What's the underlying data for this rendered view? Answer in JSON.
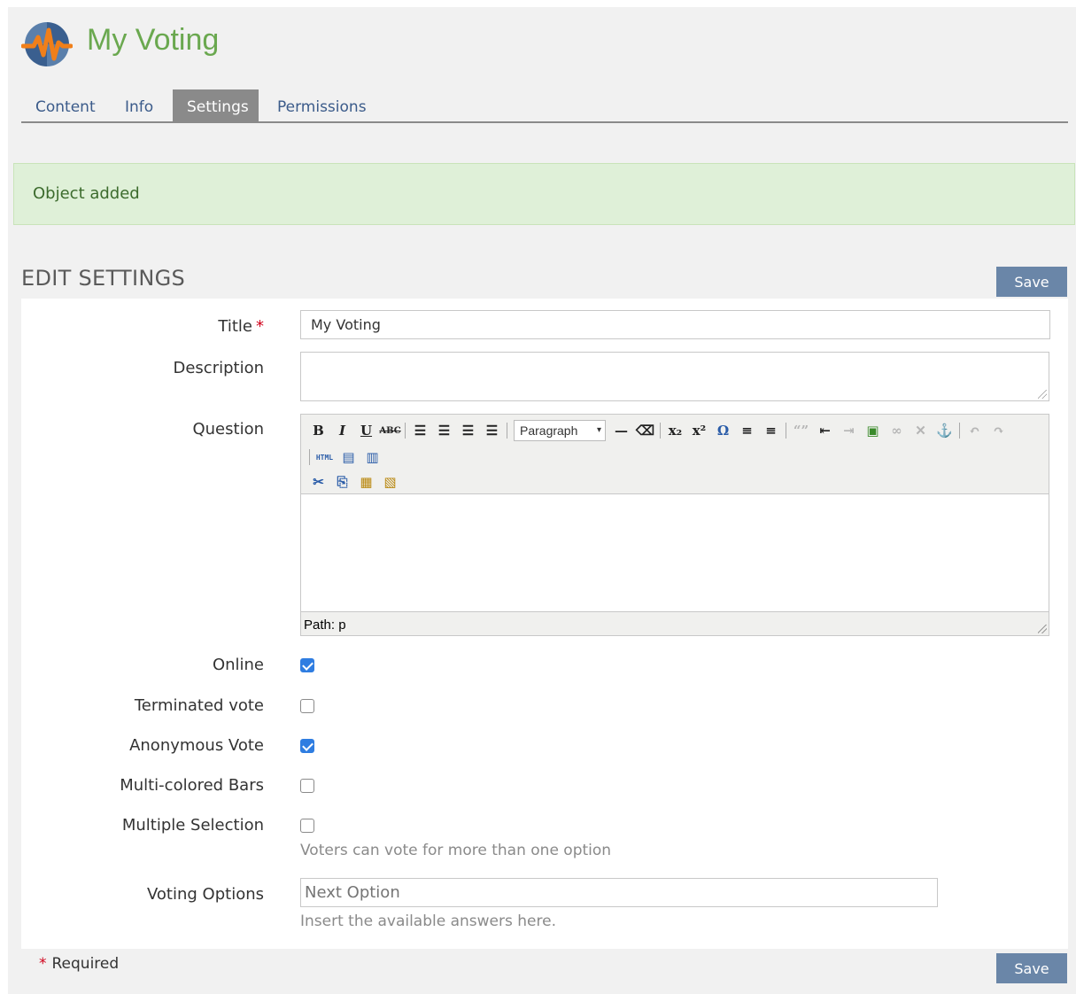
{
  "header": {
    "title": "My Voting"
  },
  "tabs": [
    {
      "label": "Content"
    },
    {
      "label": "Info"
    },
    {
      "label": "Settings",
      "active": true
    },
    {
      "label": "Permissions"
    }
  ],
  "alert": {
    "message": "Object added"
  },
  "section": {
    "title": "EDIT SETTINGS",
    "save_label": "Save"
  },
  "form": {
    "title": {
      "label": "Title",
      "required_mark": "*",
      "value": "My Voting"
    },
    "description": {
      "label": "Description",
      "value": ""
    },
    "question": {
      "label": "Question",
      "format_select": "Paragraph",
      "path_text": "Path: p",
      "toolbar_text": {
        "abc": "ABC",
        "html": "HTML"
      }
    },
    "online": {
      "label": "Online",
      "checked": true
    },
    "terminated_vote": {
      "label": "Terminated vote",
      "checked": false
    },
    "anonymous_vote": {
      "label": "Anonymous Vote",
      "checked": true
    },
    "multi_colored_bars": {
      "label": "Multi-colored Bars",
      "checked": false
    },
    "multiple_selection": {
      "label": "Multiple Selection",
      "checked": false,
      "help": "Voters can vote for more than one option"
    },
    "voting_options": {
      "label": "Voting Options",
      "placeholder": "Next Option",
      "help": "Insert the available answers here."
    }
  },
  "footer": {
    "required_mark": "*",
    "required_label": "Required",
    "save_label": "Save"
  },
  "colors": {
    "brand_green": "#6aa84f",
    "tab_active": "#8a8a8a",
    "alert_bg": "#dff0d8",
    "save_button": "#6a86a8",
    "checkbox_checked": "#2f7de1"
  }
}
